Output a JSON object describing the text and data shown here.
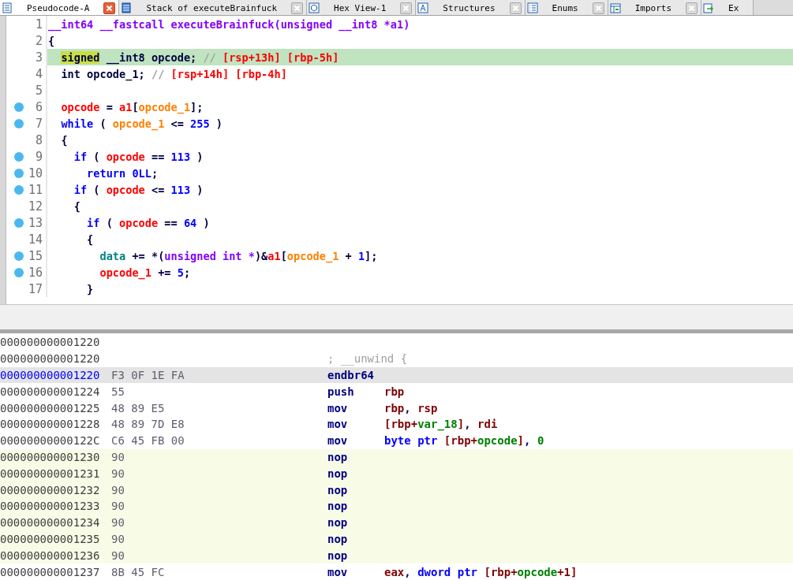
{
  "tabs": [
    {
      "label": "Pseudocode-A",
      "selected": true
    },
    {
      "label": "Stack of executeBrainfuck",
      "selected": false
    },
    {
      "label": "Hex View-1",
      "selected": false
    },
    {
      "label": "Structures",
      "selected": false
    },
    {
      "label": "Enums",
      "selected": false
    },
    {
      "label": "Imports",
      "selected": false
    },
    {
      "label": "Ex",
      "selected": false
    }
  ],
  "pseudocode": {
    "lines": [
      {
        "number": "1",
        "mapped": false,
        "selected": false,
        "tokens": [
          {
            "text": "__int64 __fastcall executeBrainfuck(unsigned __int8 *a1)",
            "kind": "type"
          }
        ]
      },
      {
        "number": "2",
        "mapped": false,
        "selected": false,
        "tokens": [
          {
            "text": "{",
            "kind": "plain"
          }
        ]
      },
      {
        "number": "3",
        "mapped": false,
        "selected": true,
        "tokens": [
          {
            "text": "  signed",
            "kind": "plain",
            "highlight": true
          },
          {
            "text": " __int8 opcode; ",
            "kind": "plain"
          },
          {
            "text": "// ",
            "kind": "comment"
          },
          {
            "text": "[rsp+13h] [rbp-5h]",
            "kind": "stack"
          }
        ]
      },
      {
        "number": "4",
        "mapped": false,
        "selected": false,
        "tokens": [
          {
            "text": "  int opcode_1; ",
            "kind": "plain"
          },
          {
            "text": "// ",
            "kind": "comment"
          },
          {
            "text": "[rsp+14h] [rbp-4h]",
            "kind": "stack"
          }
        ]
      },
      {
        "number": "5",
        "mapped": false,
        "selected": false
      },
      {
        "number": "6",
        "mapped": true,
        "selected": false,
        "tokens": [
          {
            "text": "  opcode",
            "kind": "var"
          },
          {
            "text": " = ",
            "kind": "plain"
          },
          {
            "text": "a1",
            "kind": "var"
          },
          {
            "text": "[",
            "kind": "plain"
          },
          {
            "text": "opcode_1",
            "kind": "idx"
          },
          {
            "text": "];",
            "kind": "plain"
          }
        ]
      },
      {
        "number": "7",
        "mapped": true,
        "selected": false,
        "tokens": [
          {
            "text": "  while",
            "kind": "kw"
          },
          {
            "text": " ( ",
            "kind": "plain"
          },
          {
            "text": "opcode_1",
            "kind": "idx"
          },
          {
            "text": " <= ",
            "kind": "plain"
          },
          {
            "text": "255",
            "kind": "num"
          },
          {
            "text": " )",
            "kind": "plain"
          }
        ]
      },
      {
        "number": "8",
        "mapped": false,
        "selected": false,
        "tokens": [
          {
            "text": "  {",
            "kind": "plain"
          }
        ]
      },
      {
        "number": "9",
        "mapped": true,
        "selected": false,
        "tokens": [
          {
            "text": "    if",
            "kind": "kw"
          },
          {
            "text": " ( ",
            "kind": "plain"
          },
          {
            "text": "opcode",
            "kind": "var"
          },
          {
            "text": " == ",
            "kind": "plain"
          },
          {
            "text": "113",
            "kind": "num"
          },
          {
            "text": " )",
            "kind": "plain"
          }
        ]
      },
      {
        "number": "10",
        "mapped": true,
        "selected": false,
        "tokens": [
          {
            "text": "      return ",
            "kind": "kw"
          },
          {
            "text": "0LL",
            "kind": "num"
          },
          {
            "text": ";",
            "kind": "plain"
          }
        ]
      },
      {
        "number": "11",
        "mapped": true,
        "selected": false,
        "tokens": [
          {
            "text": "    if",
            "kind": "kw"
          },
          {
            "text": " ( ",
            "kind": "plain"
          },
          {
            "text": "opcode",
            "kind": "var"
          },
          {
            "text": " <= ",
            "kind": "plain"
          },
          {
            "text": "113",
            "kind": "num"
          },
          {
            "text": " )",
            "kind": "plain"
          }
        ]
      },
      {
        "number": "12",
        "mapped": false,
        "selected": false,
        "tokens": [
          {
            "text": "    {",
            "kind": "plain"
          }
        ]
      },
      {
        "number": "13",
        "mapped": true,
        "selected": false,
        "tokens": [
          {
            "text": "      if",
            "kind": "kw"
          },
          {
            "text": " ( ",
            "kind": "plain"
          },
          {
            "text": "opcode",
            "kind": "var"
          },
          {
            "text": " == ",
            "kind": "plain"
          },
          {
            "text": "64",
            "kind": "num"
          },
          {
            "text": " )",
            "kind": "plain"
          }
        ]
      },
      {
        "number": "14",
        "mapped": false,
        "selected": false,
        "tokens": [
          {
            "text": "      {",
            "kind": "plain"
          }
        ]
      },
      {
        "number": "15",
        "mapped": true,
        "selected": false,
        "tokens": [
          {
            "text": "        data",
            "kind": "global"
          },
          {
            "text": " += *(",
            "kind": "plain"
          },
          {
            "text": "unsigned int *",
            "kind": "type"
          },
          {
            "text": ")&",
            "kind": "plain"
          },
          {
            "text": "a1",
            "kind": "var"
          },
          {
            "text": "[",
            "kind": "plain"
          },
          {
            "text": "opcode_1",
            "kind": "idx"
          },
          {
            "text": " + ",
            "kind": "plain"
          },
          {
            "text": "1",
            "kind": "num"
          },
          {
            "text": "];",
            "kind": "plain"
          }
        ]
      },
      {
        "number": "16",
        "mapped": true,
        "selected": false,
        "tokens": [
          {
            "text": "        opcode_1",
            "kind": "var"
          },
          {
            "text": " += ",
            "kind": "plain"
          },
          {
            "text": "5",
            "kind": "num"
          },
          {
            "text": ";",
            "kind": "plain"
          }
        ]
      },
      {
        "number": "17",
        "mapped": false,
        "selected": false,
        "tokens": [
          {
            "text": "      }",
            "kind": "plain"
          }
        ]
      }
    ]
  },
  "disassembly": {
    "rows": [
      {
        "address": "000000000001220",
        "selected": false,
        "marked": false
      },
      {
        "address": "000000000001220",
        "comment": "; __unwind {",
        "selected": false,
        "marked": false
      },
      {
        "address": "000000000001220",
        "bytes": "F3 0F 1E FA",
        "mnemonic": "endbr64",
        "selected": true,
        "marked": false
      },
      {
        "address": "000000000001224",
        "bytes": "55",
        "mnemonic": "push",
        "operands": [
          {
            "text": "rbp",
            "kind": "reg"
          }
        ],
        "selected": false,
        "marked": false
      },
      {
        "address": "000000000001225",
        "bytes": "48 89 E5",
        "mnemonic": "mov",
        "operands": [
          {
            "text": "rbp",
            "kind": "reg"
          },
          {
            "text": ", ",
            "kind": "plain"
          },
          {
            "text": "rsp",
            "kind": "reg"
          }
        ],
        "selected": false,
        "marked": false
      },
      {
        "address": "000000000001228",
        "bytes": "48 89 7D E8",
        "mnemonic": "mov",
        "operands": [
          {
            "text": "[rbp+",
            "kind": "reg"
          },
          {
            "text": "var_18",
            "kind": "var"
          },
          {
            "text": "]",
            "kind": "reg"
          },
          {
            "text": ", ",
            "kind": "plain"
          },
          {
            "text": "rdi",
            "kind": "reg"
          }
        ],
        "selected": false,
        "marked": false
      },
      {
        "address": "00000000000122C",
        "bytes": "C6 45 FB 00",
        "mnemonic": "mov",
        "operands": [
          {
            "text": "byte ptr ",
            "kind": "kw"
          },
          {
            "text": "[rbp+",
            "kind": "reg"
          },
          {
            "text": "opcode",
            "kind": "var"
          },
          {
            "text": "]",
            "kind": "reg"
          },
          {
            "text": ", ",
            "kind": "plain"
          },
          {
            "text": "0",
            "kind": "num"
          }
        ],
        "selected": false,
        "marked": false
      },
      {
        "address": "000000000001230",
        "bytes": "90",
        "mnemonic": "nop",
        "selected": false,
        "marked": true
      },
      {
        "address": "000000000001231",
        "bytes": "90",
        "mnemonic": "nop",
        "selected": false,
        "marked": true
      },
      {
        "address": "000000000001232",
        "bytes": "90",
        "mnemonic": "nop",
        "selected": false,
        "marked": true
      },
      {
        "address": "000000000001233",
        "bytes": "90",
        "mnemonic": "nop",
        "selected": false,
        "marked": true
      },
      {
        "address": "000000000001234",
        "bytes": "90",
        "mnemonic": "nop",
        "selected": false,
        "marked": true
      },
      {
        "address": "000000000001235",
        "bytes": "90",
        "mnemonic": "nop",
        "selected": false,
        "marked": true
      },
      {
        "address": "000000000001236",
        "bytes": "90",
        "mnemonic": "nop",
        "selected": false,
        "marked": true
      },
      {
        "address": "000000000001237",
        "bytes": "8B 45 FC",
        "mnemonic": "mov",
        "operands": [
          {
            "text": "eax",
            "kind": "reg"
          },
          {
            "text": ", ",
            "kind": "plain"
          },
          {
            "text": "dword ptr ",
            "kind": "kw"
          },
          {
            "text": "[rbp+",
            "kind": "reg"
          },
          {
            "text": "opcode",
            "kind": "var"
          },
          {
            "text": "+1]",
            "kind": "reg"
          }
        ],
        "selected": false,
        "marked": false
      }
    ]
  }
}
